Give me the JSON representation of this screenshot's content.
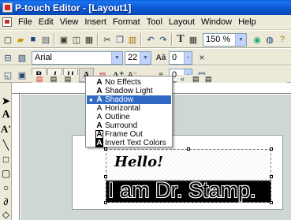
{
  "window": {
    "title": "P-touch Editor - [Layout1]"
  },
  "menubar": {
    "items": [
      "File",
      "Edit",
      "View",
      "Insert",
      "Format",
      "Tool",
      "Layout",
      "Window",
      "Help"
    ]
  },
  "toolbar1": {
    "zoom": "150 %",
    "text_button": "T"
  },
  "toolbar2": {
    "font": "Arial",
    "size": "22",
    "spacing1": "0",
    "spacing2": "0"
  },
  "toolbar3": {
    "bold": "B",
    "italic": "I",
    "underline": "U",
    "effect": "A"
  },
  "effects_menu": {
    "selected_index": 2,
    "items": [
      "No Effects",
      "Shadow Light",
      "Shadow",
      "Horizontal",
      "Outline",
      "Surround",
      "Frame Out",
      "Invert Text Colors"
    ]
  },
  "canvas": {
    "text1": "Hello!",
    "text2": "I am Dr. Stamp."
  },
  "colors": {
    "accent": "#316ac5",
    "titlebar": "#0a58d0"
  }
}
